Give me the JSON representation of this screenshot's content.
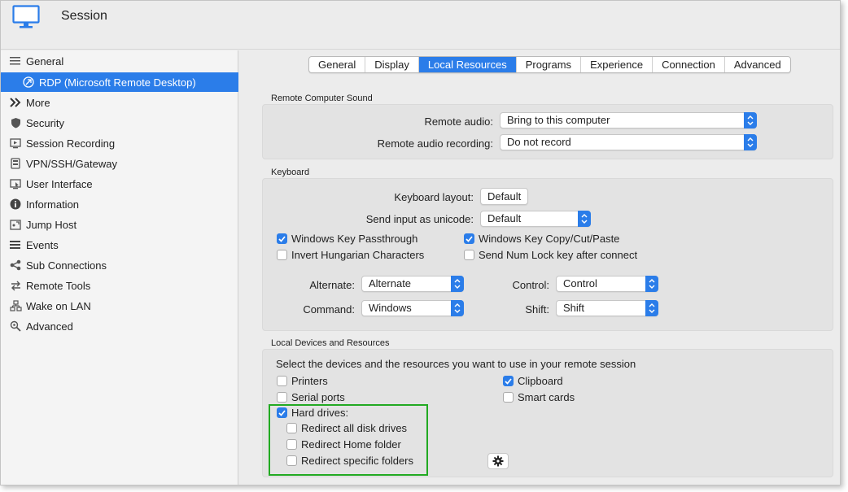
{
  "header": {
    "title": "Session"
  },
  "sidebar": {
    "items": [
      {
        "label": "General",
        "icon": "hamburger-icon"
      },
      {
        "label": "RDP (Microsoft Remote Desktop)",
        "icon": "rdp-icon"
      },
      {
        "label": "More",
        "icon": "double-chevron-icon"
      },
      {
        "label": "Security",
        "icon": "shield-icon"
      },
      {
        "label": "Session Recording",
        "icon": "recording-icon"
      },
      {
        "label": "VPN/SSH/Gateway",
        "icon": "vpn-icon"
      },
      {
        "label": "User Interface",
        "icon": "user-interface-icon"
      },
      {
        "label": "Information",
        "icon": "info-icon"
      },
      {
        "label": "Jump Host",
        "icon": "jump-host-icon"
      },
      {
        "label": "Events",
        "icon": "events-icon"
      },
      {
        "label": "Sub Connections",
        "icon": "share-icon"
      },
      {
        "label": "Remote Tools",
        "icon": "arrows-icon"
      },
      {
        "label": "Wake on LAN",
        "icon": "network-icon"
      },
      {
        "label": "Advanced",
        "icon": "magnifier-gear-icon"
      }
    ]
  },
  "tabs": [
    "General",
    "Display",
    "Local Resources",
    "Programs",
    "Experience",
    "Connection",
    "Advanced"
  ],
  "sound": {
    "group_label": "Remote Computer Sound",
    "remote_audio_label": "Remote audio:",
    "remote_audio_value": "Bring to this computer",
    "recording_label": "Remote audio recording:",
    "recording_value": "Do not record"
  },
  "keyboard": {
    "group_label": "Keyboard",
    "layout_label": "Keyboard layout:",
    "layout_value": "Default",
    "unicode_label": "Send input as unicode:",
    "unicode_value": "Default",
    "win_passthrough": "Windows Key Passthrough",
    "win_copy": "Windows Key Copy/Cut/Paste",
    "invert_hungarian": "Invert Hungarian Characters",
    "num_lock": "Send Num Lock key after connect",
    "alternate_label": "Alternate:",
    "alternate_value": "Alternate",
    "control_label": "Control:",
    "control_value": "Control",
    "command_label": "Command:",
    "command_value": "Windows",
    "shift_label": "Shift:",
    "shift_value": "Shift"
  },
  "devices": {
    "group_label": "Local Devices and Resources",
    "instruction": "Select the devices and the resources you want to use in your remote session",
    "printers": "Printers",
    "serial_ports": "Serial ports",
    "hard_drives": "Hard drives:",
    "redirect_all": "Redirect all disk drives",
    "redirect_home": "Redirect Home folder",
    "redirect_specific": "Redirect specific folders",
    "clipboard": "Clipboard",
    "smart_cards": "Smart cards"
  },
  "colors": {
    "accent": "#2b7de9",
    "highlight": "#22aa22"
  }
}
